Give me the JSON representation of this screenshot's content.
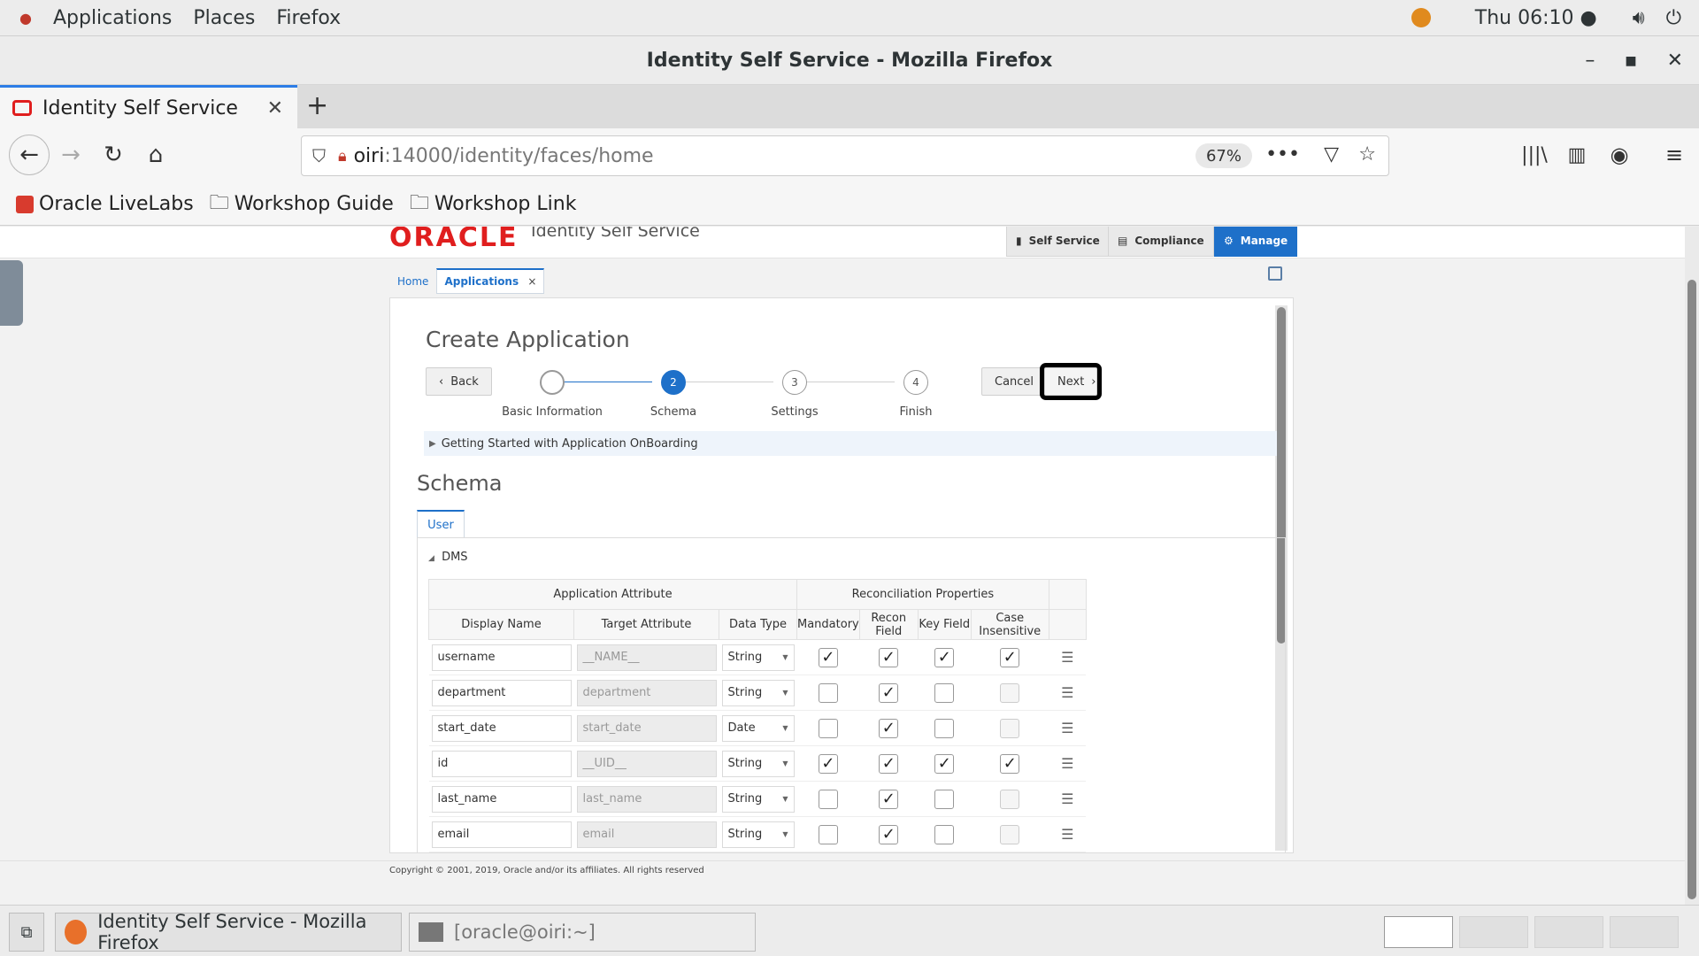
{
  "gnome_bar": {
    "menus": [
      "Applications",
      "Places",
      "Firefox"
    ],
    "clock": "Thu 06:10 ●"
  },
  "window": {
    "title": "Identity Self Service - Mozilla Firefox"
  },
  "browser": {
    "tab_title": "Identity Self Service",
    "url_host": "oiri",
    "url_path": ":14000/identity/faces/home",
    "zoom": "67%",
    "bookmarks": [
      "Oracle LiveLabs",
      "Workshop Guide",
      "Workshop Link"
    ]
  },
  "app": {
    "brand": "ORACLE",
    "name": "Identity Self Service",
    "header_buttons": [
      "Self Service",
      "Compliance",
      "Manage"
    ],
    "active_header": "Manage",
    "page_tabs": [
      "Home",
      "Applications"
    ],
    "page_tab_close": "×"
  },
  "wizard": {
    "title": "Create Application",
    "back_label": "Back",
    "cancel_label": "Cancel",
    "next_label": "Next",
    "steps": [
      {
        "number": "",
        "label": "Basic Information",
        "state": "done"
      },
      {
        "number": "2",
        "label": "Schema",
        "state": "current"
      },
      {
        "number": "3",
        "label": "Settings",
        "state": "pending"
      },
      {
        "number": "4",
        "label": "Finish",
        "state": "pending"
      }
    ],
    "getting_started": "Getting Started with Application OnBoarding"
  },
  "schema": {
    "title": "Schema",
    "tab": "User",
    "group": "DMS",
    "header_groups": {
      "app_attr": "Application Attribute",
      "recon": "Reconciliation Properties"
    },
    "columns": [
      "Display Name",
      "Target Attribute",
      "Data Type",
      "Mandatory",
      "Recon Field",
      "Key Field",
      "Case Insensitive"
    ],
    "rows": [
      {
        "display": "username",
        "target": "__NAME__",
        "type": "String",
        "mandatory": true,
        "recon": true,
        "key": true,
        "case": true,
        "case_enabled": true
      },
      {
        "display": "department",
        "target": "department",
        "type": "String",
        "mandatory": false,
        "recon": true,
        "key": false,
        "case": false,
        "case_enabled": false
      },
      {
        "display": "start_date",
        "target": "start_date",
        "type": "Date",
        "mandatory": false,
        "recon": true,
        "key": false,
        "case": false,
        "case_enabled": false
      },
      {
        "display": "id",
        "target": "__UID__",
        "type": "String",
        "mandatory": true,
        "recon": true,
        "key": true,
        "case": true,
        "case_enabled": true
      },
      {
        "display": "last_name",
        "target": "last_name",
        "type": "String",
        "mandatory": false,
        "recon": true,
        "key": false,
        "case": false,
        "case_enabled": false
      },
      {
        "display": "email",
        "target": "email",
        "type": "String",
        "mandatory": false,
        "recon": true,
        "key": false,
        "case": false,
        "case_enabled": false
      }
    ]
  },
  "footer": {
    "copyright": "Copyright © 2001, 2019, Oracle and/or its affiliates. All rights reserved"
  },
  "taskbar": {
    "tasks": [
      "Identity Self Service - Mozilla Firefox",
      "[oracle@oiri:~]"
    ]
  }
}
